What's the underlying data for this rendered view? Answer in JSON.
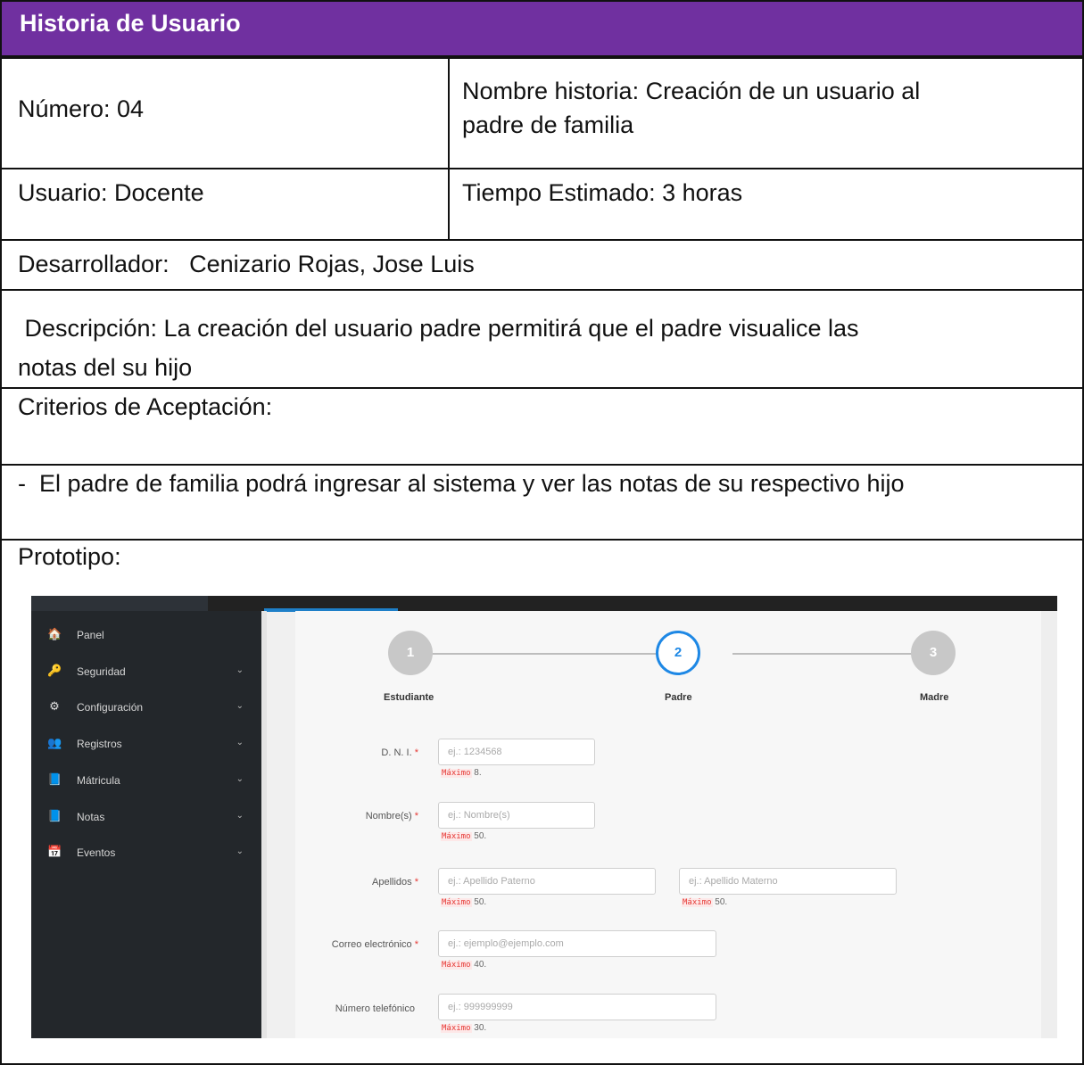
{
  "header": {
    "title": "Historia de Usuario"
  },
  "rows": {
    "numero": "Número: 04",
    "nombre_line1": "Nombre historia: Creación de un usuario al",
    "nombre_line2": "padre de familia",
    "usuario": "Usuario: Docente",
    "tiempo": "Tiempo Estimado: 3 horas",
    "desarrollador": "Desarrollador:   Cenizario Rojas, Jose Luis",
    "descripcion_line1": " Descripción: La creación del usuario padre permitirá que el padre visualice las",
    "descripcion_line2": "notas del su hijo",
    "criterios_title": "Criterios de Aceptación:",
    "criterios_item": "-  El padre de familia podrá ingresar al sistema y ver las notas de su respectivo hijo",
    "prototipo": "Prototipo:"
  },
  "prototype": {
    "sidebar": [
      {
        "icon": "home-icon",
        "glyph": "🏠",
        "label": "Panel",
        "chevron": false
      },
      {
        "icon": "key-icon",
        "glyph": "🔑",
        "label": "Seguridad",
        "chevron": true
      },
      {
        "icon": "gears-icon",
        "glyph": "⚙",
        "label": "Configuración",
        "chevron": true
      },
      {
        "icon": "users-icon",
        "glyph": "👥",
        "label": "Registros",
        "chevron": true
      },
      {
        "icon": "book-icon",
        "glyph": "📘",
        "label": "Mátricula",
        "chevron": true
      },
      {
        "icon": "book-icon",
        "glyph": "📘",
        "label": "Notas",
        "chevron": true
      },
      {
        "icon": "calendar-icon",
        "glyph": "📅",
        "label": "Eventos",
        "chevron": true
      }
    ],
    "chevron_glyph": "⌄",
    "steps": [
      {
        "number": "1",
        "label": "Estudiante",
        "active": false
      },
      {
        "number": "2",
        "label": "Padre",
        "active": true
      },
      {
        "number": "3",
        "label": "Madre",
        "active": false
      }
    ],
    "form": {
      "dni": {
        "label": "D. N. I.",
        "required": "*",
        "placeholder": "ej.: 1234568",
        "hint_code": "Máximo",
        "hint_val": "8."
      },
      "nombres": {
        "label": "Nombre(s)",
        "required": "*",
        "placeholder": "ej.: Nombre(s)",
        "hint_code": "Máximo",
        "hint_val": "50."
      },
      "apellidos": {
        "label": "Apellidos",
        "required": "*",
        "placeholder_paterno": "ej.: Apellido Paterno",
        "placeholder_materno": "ej.: Apellido Materno",
        "hint_code": "Máximo",
        "hint_val": "50."
      },
      "correo": {
        "label": "Correo electrónico",
        "required": "*",
        "placeholder": "ej.: ejemplo@ejemplo.com",
        "hint_code": "Máximo",
        "hint_val": "40."
      },
      "telefono": {
        "label": "Número telefónico",
        "placeholder": "ej.: 999999999",
        "hint_code": "Máximo",
        "hint_val": "30."
      }
    },
    "colors": {
      "accent": "#1e88e5",
      "header_bg": "#7030a0",
      "sidebar_bg": "#23272b"
    }
  }
}
